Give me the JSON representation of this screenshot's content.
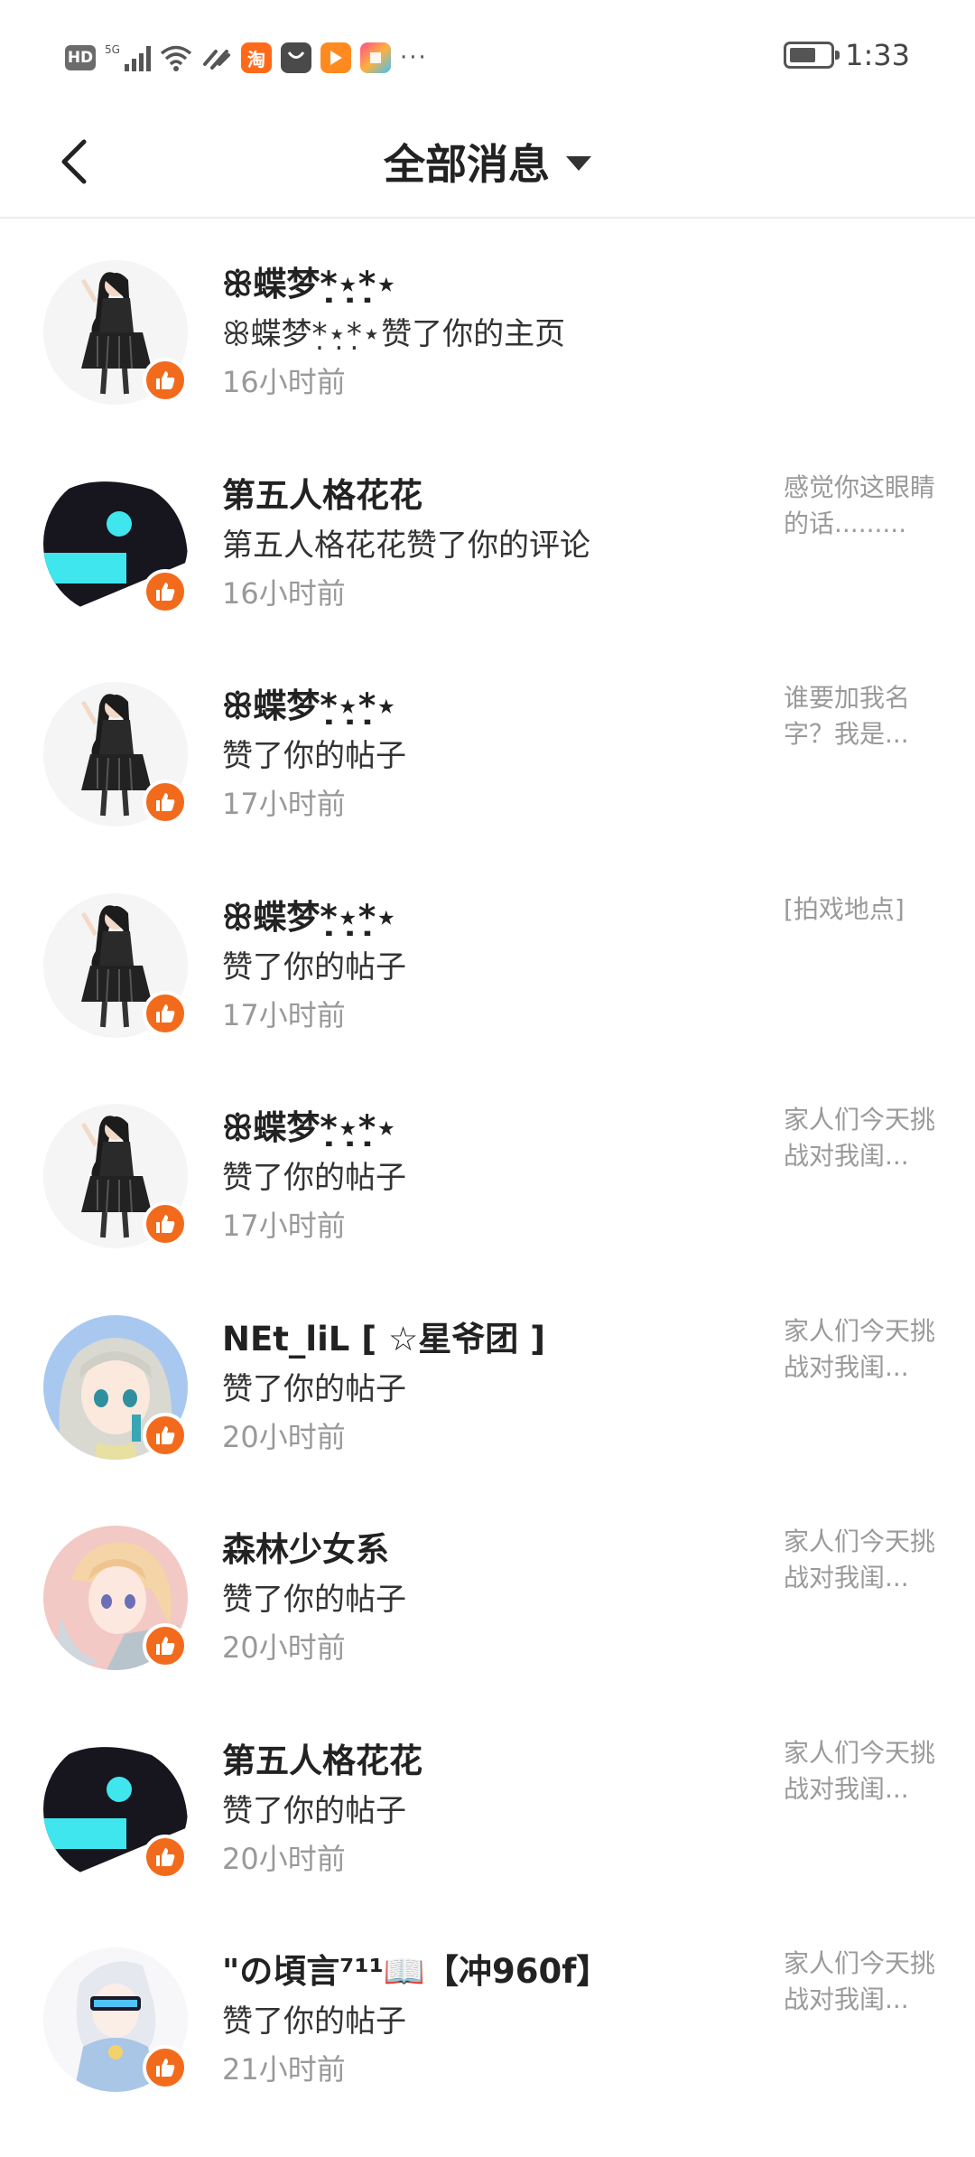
{
  "status_bar": {
    "hd": "HD",
    "network": "5G",
    "network_sub": "1",
    "app_icon_taobao": "淘",
    "more": "···",
    "time": "1:33"
  },
  "header": {
    "title": "全部消息"
  },
  "colors": {
    "like_badge": "#f26b1d",
    "time_text": "#999999",
    "snippet_text": "#9a9a9a"
  },
  "messages": [
    {
      "name": "ꕥ蝶梦*̣⋆̣*̣⋆",
      "action": "ꕥ蝶梦*̣⋆̣*̣⋆赞了你的主页",
      "time": "16小时前",
      "snippet": "",
      "avatar": "gothic-girl"
    },
    {
      "name": "第五人格花花",
      "action": "第五人格花花赞了你的评论",
      "time": "16小时前",
      "snippet": "感觉你这眼睛的话.........",
      "avatar": "dark-cyan"
    },
    {
      "name": "ꕥ蝶梦*̣⋆̣*̣⋆",
      "action": "赞了你的帖子",
      "time": "17小时前",
      "snippet": "谁要加我名字？我是...",
      "avatar": "gothic-girl"
    },
    {
      "name": "ꕥ蝶梦*̣⋆̣*̣⋆",
      "action": "赞了你的帖子",
      "time": "17小时前",
      "snippet": "[拍戏地点]",
      "avatar": "gothic-girl"
    },
    {
      "name": "ꕥ蝶梦*̣⋆̣*̣⋆",
      "action": "赞了你的帖子",
      "time": "17小时前",
      "snippet": "家人们今天挑战对我闺...",
      "avatar": "gothic-girl"
    },
    {
      "name": "NEt_liL [ ☆星爷团 ]",
      "action": "赞了你的帖子",
      "time": "20小时前",
      "snippet": "家人们今天挑战对我闺...",
      "avatar": "silver-hair"
    },
    {
      "name": "森林少女系",
      "action": "赞了你的帖子",
      "time": "20小时前",
      "snippet": "家人们今天挑战对我闺...",
      "avatar": "blonde-girl"
    },
    {
      "name": "第五人格花花",
      "action": "赞了你的帖子",
      "time": "20小时前",
      "snippet": "家人们今天挑战对我闺...",
      "avatar": "dark-cyan"
    },
    {
      "name": "\"の頃言⁷¹¹📖【冲960f】",
      "action": "赞了你的帖子",
      "time": "21小时前",
      "snippet": "家人们今天挑战对我闺...",
      "avatar": "white-hair"
    }
  ]
}
